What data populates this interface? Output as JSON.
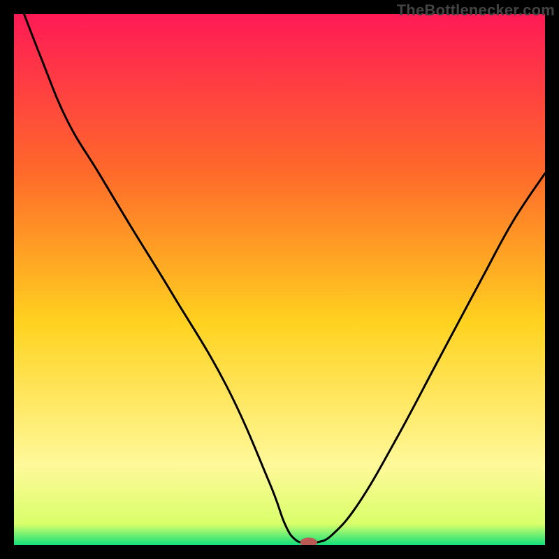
{
  "watermark": "TheBottlenecker.com",
  "colors": {
    "frame": "#000000",
    "gradient_top": "#ff1a55",
    "gradient_mid_upper": "#ff6a2a",
    "gradient_mid": "#ffd21f",
    "gradient_lower": "#fff99a",
    "gradient_bottom": "#12e07a",
    "curve": "#000000",
    "marker": "#bb5a55"
  },
  "chart_data": {
    "type": "line",
    "title": "",
    "xlabel": "",
    "ylabel": "",
    "xlim": [
      0,
      100
    ],
    "ylim": [
      0,
      100
    ],
    "grid": false,
    "series": [
      {
        "name": "bottleneck-curve",
        "x": [
          0,
          5,
          10,
          16,
          22,
          30,
          40,
          48,
          51,
          53,
          55,
          57,
          60,
          65,
          72,
          80,
          88,
          94,
          100
        ],
        "y": [
          105,
          92,
          80,
          70,
          60,
          47,
          30,
          12,
          4,
          1,
          0.5,
          0.5,
          2,
          8,
          20,
          35,
          50,
          61,
          70
        ]
      }
    ],
    "marker": {
      "x": 55.5,
      "y": 0.5,
      "rx": 1.6,
      "ry": 0.9
    },
    "notes": "V-shaped bottleneck curve on a vertical red→orange→yellow→green gradient; minimum occurs around x≈55; small rounded marker sits at the minimum on the baseline."
  }
}
